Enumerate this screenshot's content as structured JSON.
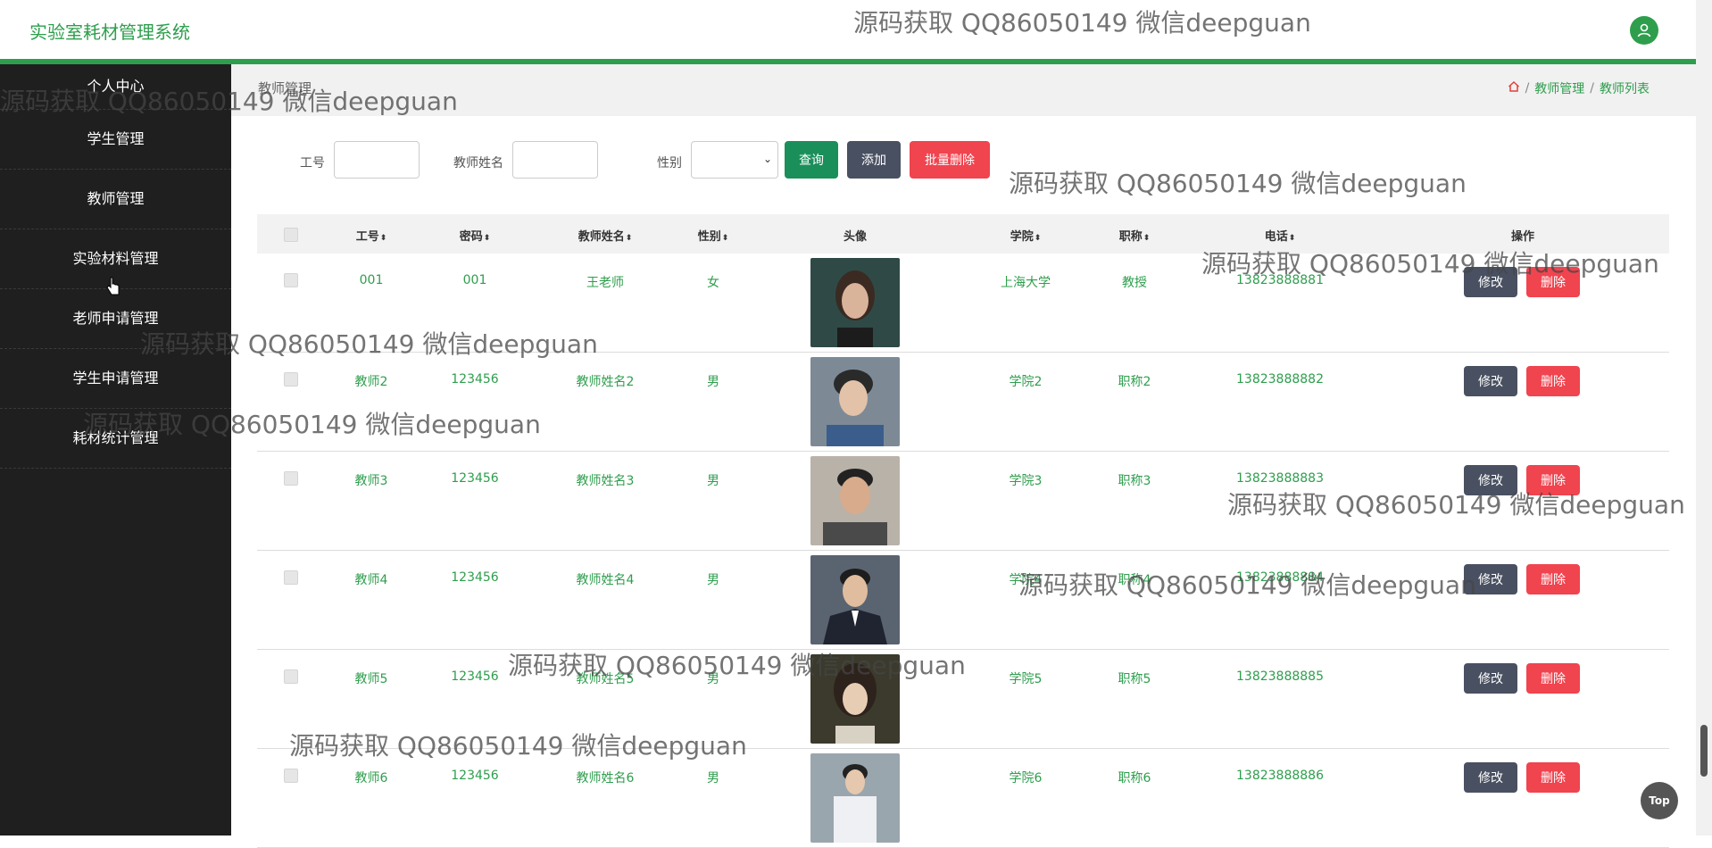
{
  "app": {
    "title": "实验室耗材管理系统"
  },
  "sidebar": {
    "items": [
      {
        "label": "个人中心"
      },
      {
        "label": "学生管理"
      },
      {
        "label": "教师管理"
      },
      {
        "label": "实验材料管理"
      },
      {
        "label": "老师申请管理"
      },
      {
        "label": "学生申请管理"
      },
      {
        "label": "耗材统计管理"
      }
    ]
  },
  "page": {
    "title": "教师管理",
    "breadcrumb": [
      "教师管理",
      "教师列表"
    ]
  },
  "search": {
    "id_label": "工号",
    "name_label": "教师姓名",
    "gender_label": "性别",
    "query_button": "查询",
    "add_button": "添加",
    "batch_delete_button": "批量删除"
  },
  "table": {
    "headers": [
      "工号",
      "密码",
      "教师姓名",
      "性别",
      "头像",
      "学院",
      "职称",
      "电话",
      "操作"
    ],
    "edit_label": "修改",
    "delete_label": "删除",
    "rows": [
      {
        "id": "001",
        "password": "001",
        "name": "王老师",
        "gender": "女",
        "college": "上海大学",
        "title": "教授",
        "phone": "13823888881"
      },
      {
        "id": "教师2",
        "password": "123456",
        "name": "教师姓名2",
        "gender": "男",
        "college": "学院2",
        "title": "职称2",
        "phone": "13823888882"
      },
      {
        "id": "教师3",
        "password": "123456",
        "name": "教师姓名3",
        "gender": "男",
        "college": "学院3",
        "title": "职称3",
        "phone": "13823888883"
      },
      {
        "id": "教师4",
        "password": "123456",
        "name": "教师姓名4",
        "gender": "男",
        "college": "学院4",
        "title": "职称4",
        "phone": "13823888884"
      },
      {
        "id": "教师5",
        "password": "123456",
        "name": "教师姓名5",
        "gender": "男",
        "college": "学院5",
        "title": "职称5",
        "phone": "13823888885"
      },
      {
        "id": "教师6",
        "password": "123456",
        "name": "教师姓名6",
        "gender": "男",
        "college": "学院6",
        "title": "职称6",
        "phone": "13823888886"
      }
    ]
  },
  "watermark": "源码获取 QQ86050149 微信deepguan",
  "top_button": "Top",
  "colors": {
    "accent": "#2e9e4d",
    "sidebar": "#1f1f1f",
    "edit": "#495061",
    "delete": "#f0444f"
  }
}
